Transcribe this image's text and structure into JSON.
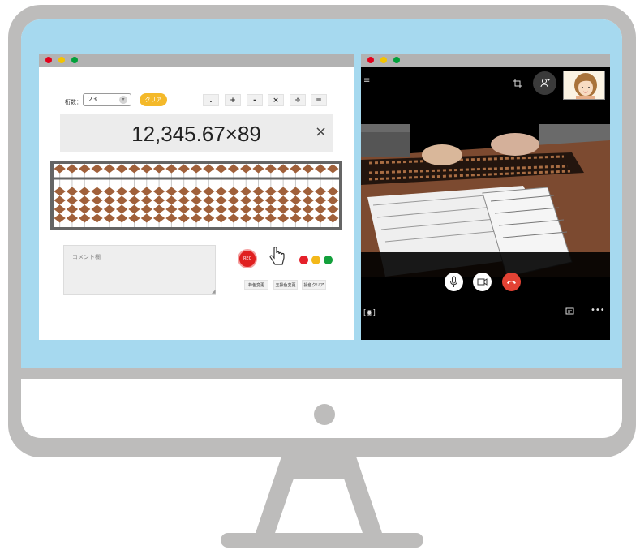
{
  "left_app": {
    "keta_label": "桁数：",
    "keta_value": "23",
    "clear_label": "クリア",
    "ops": [
      ".",
      "+",
      "-",
      "×",
      "÷",
      "="
    ],
    "expression": "12,345.67×89",
    "close_glyph": "×",
    "comment_placeholder": "コメント欄",
    "rec_label": "REC",
    "buttons": [
      "枠色変更",
      "玉操色変更",
      "操色クリア"
    ],
    "colors": {
      "red": "#e5202a",
      "yellow": "#f3b81a",
      "green": "#13a03c",
      "bead": "#a0603a"
    }
  },
  "right_app": {
    "icons": [
      "menu-icon",
      "crop-icon",
      "add-person-icon",
      "mic-icon",
      "camera-icon",
      "hangup-icon",
      "screenshot-icon",
      "chat-icon",
      "more-icon"
    ]
  }
}
